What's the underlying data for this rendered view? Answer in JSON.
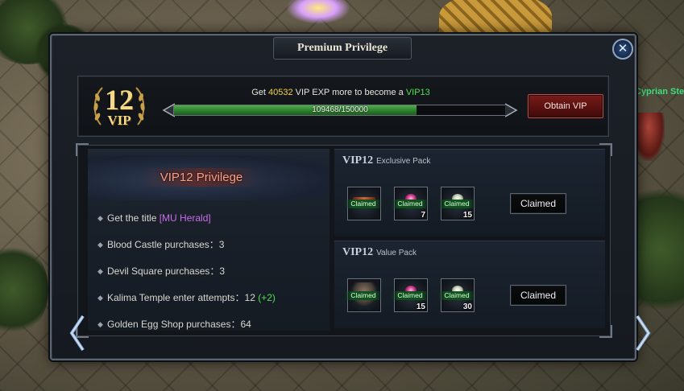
{
  "window": {
    "title": "Premium Privilege"
  },
  "scene": {
    "npc_name": "Cyprian Stewar"
  },
  "vip": {
    "level_number": "12",
    "level_tag": "VIP",
    "msg_prefix": "Get ",
    "exp_needed": "40532",
    "msg_middle": " VIP EXP more to become a ",
    "next_level": "VIP13",
    "progress_text": "109468/150000",
    "progress_current": 109468,
    "progress_max": 150000,
    "obtain_label": "Obtain VIP"
  },
  "privilege": {
    "title": "VIP12 Privilege",
    "items": [
      {
        "label": "Get the title ",
        "accent": "[MU Herald]"
      },
      {
        "label": "Blood Castle purchases：3"
      },
      {
        "label": "Devil Square purchases：3"
      },
      {
        "label": "Kalima Temple enter attempts：12 ",
        "plus": "(+2)"
      },
      {
        "label": "Golden Egg Shop purchases：64"
      }
    ]
  },
  "packs": [
    {
      "title": "VIP12",
      "subtitle": "Exclusive Pack",
      "items": [
        {
          "icon": "title-scroll-icon",
          "tag": "Claimed",
          "qty": ""
        },
        {
          "icon": "pink-jewel-icon",
          "tag": "Claimed",
          "qty": "7"
        },
        {
          "icon": "white-jewel-icon",
          "tag": "Claimed",
          "qty": "15"
        }
      ],
      "status_label": "Claimed"
    },
    {
      "title": "VIP12",
      "subtitle": "Value Pack",
      "items": [
        {
          "icon": "wings-icon",
          "tag": "Claimed",
          "qty": ""
        },
        {
          "icon": "pink-jewel-icon",
          "tag": "Claimed",
          "qty": "15"
        },
        {
          "icon": "white-jewel-icon",
          "tag": "Claimed",
          "qty": "30"
        }
      ],
      "status_label": "Claimed"
    }
  ],
  "colors": {
    "accent_gold": "#f1d24b",
    "accent_green": "#4fe04f",
    "title_purple": "#c96de8",
    "privilege_title": "#f2a28a"
  }
}
